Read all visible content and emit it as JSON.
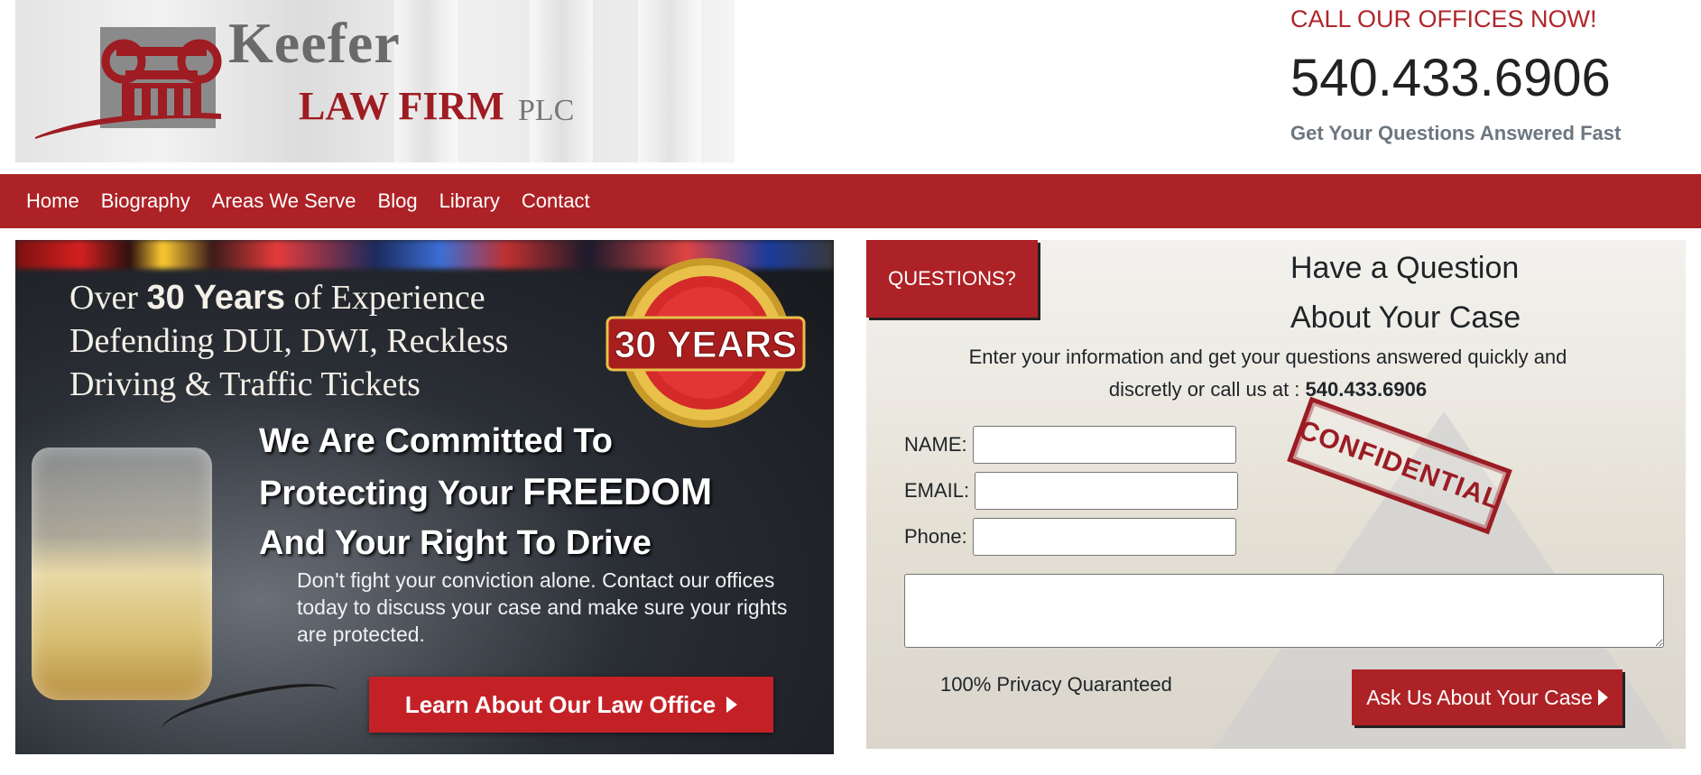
{
  "header": {
    "logo": {
      "keefer": "Keefer",
      "law_firm": "LAW FIRM",
      "plc": "PLC"
    },
    "call_line": "CALL OUR OFFICES NOW!",
    "phone": "540.433.6906",
    "tagline": "Get Your Questions Answered Fast"
  },
  "nav": {
    "items": [
      {
        "label": "Home"
      },
      {
        "label": "Biography"
      },
      {
        "label": "Areas We Serve"
      },
      {
        "label": "Blog"
      },
      {
        "label": "Library"
      },
      {
        "label": "Contact"
      }
    ]
  },
  "hero": {
    "exp_prefix": "Over ",
    "exp_years": "30 Years",
    "exp_rest": " of Experience Defending DUI, DWI, Reckless Driving & Traffic Tickets",
    "badge": "30 YEARS",
    "commit_1": "We Are Committed To",
    "commit_2a": "Protecting Your ",
    "commit_2b": "FREEDOM",
    "commit_3": "And Your Right To Drive",
    "subtext": "Don't fight your conviction alone.  Contact our offices today to discuss your case and make sure your rights are protected.",
    "cta": "Learn About Our Law Office"
  },
  "question_form": {
    "tab": "QUESTIONS?",
    "heading_1": "Have a Question",
    "heading_2": "About Your Case",
    "intro": "Enter your information and get your questions answered quickly and discretly or call us at : ",
    "intro_phone": "540.433.6906",
    "stamp": "CONFIDENTIAL",
    "name_label": "NAME:",
    "email_label": "EMAIL:",
    "phone_label": "Phone:",
    "name_value": "",
    "email_value": "",
    "phone_value": "",
    "message_value": "",
    "privacy": "100% Privacy Quaranteed",
    "submit": "Ask Us About Your Case"
  },
  "colors": {
    "brand_red": "#ad2226",
    "text_dark": "#1f2428",
    "tagline_gray": "#6c7680"
  }
}
